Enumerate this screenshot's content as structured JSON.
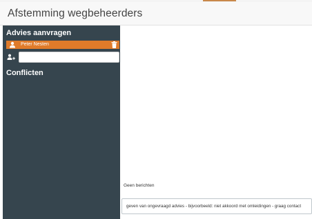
{
  "app": {
    "title": "Afstemming wegbeheerders",
    "accent_color": "#e07b2a",
    "sidebar_color": "#36454e"
  },
  "sidebar": {
    "sections": [
      {
        "title": "Advies aanvragen",
        "items": [
          {
            "name": "Peter Nesten",
            "icon": "user-icon",
            "action_icon": "trash-icon"
          }
        ],
        "add_user": {
          "icon": "add-user-icon",
          "value": "",
          "placeholder": ""
        }
      },
      {
        "title": "Conflicten"
      }
    ]
  },
  "messages": {
    "empty_text": "Geen berichten",
    "input_value": "geven van ongevraagd advies - bijvoorbeeld: niet akkoord met omleidingen - graag contact"
  }
}
